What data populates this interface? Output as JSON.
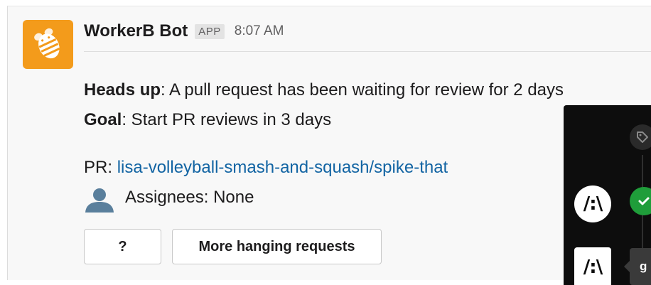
{
  "message": {
    "bot_name": "WorkerB Bot",
    "badge": "APP",
    "time": "8:07 AM",
    "avatar_icon": "bee-icon",
    "heads_up_label": "Heads up",
    "heads_up_text": ": A pull request has been waiting for review for 2 days",
    "goal_label": "Goal",
    "goal_text": ": Start PR reviews in 3 days",
    "pr_label": "PR: ",
    "pr_link": "lisa-volleyball-smash-and-squash/spike-that",
    "assignees_text": "Assignees: None",
    "buttons": {
      "question": "?",
      "more": "More hanging requests"
    }
  },
  "overlay": {
    "logo_glyph": "/:\\",
    "tooltip_text": "g"
  },
  "colors": {
    "avatar_bg": "#f39b1b",
    "link": "#1264a3",
    "success": "#1f9d3a",
    "panel_bg": "#0d0d0d"
  }
}
